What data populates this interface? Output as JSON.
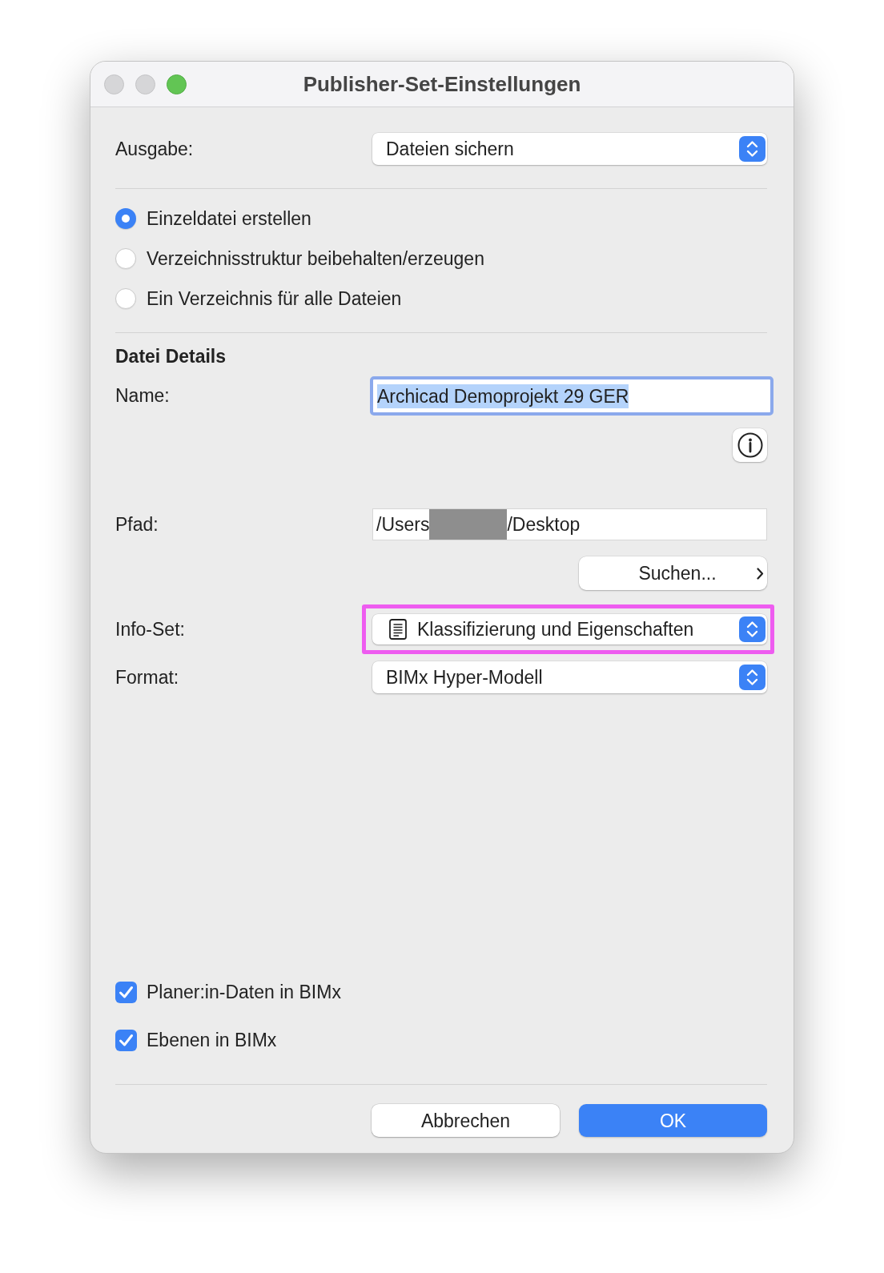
{
  "window": {
    "title": "Publisher-Set-Einstellungen",
    "controls": [
      {
        "kind": "close",
        "enabled": false
      },
      {
        "kind": "minimize",
        "enabled": false
      },
      {
        "kind": "zoom",
        "enabled": true
      }
    ]
  },
  "output": {
    "label": "Ausgabe:",
    "value": "Dateien sichern"
  },
  "file_options": [
    {
      "label": "Einzeldatei erstellen",
      "selected": true
    },
    {
      "label": "Verzeichnisstruktur beibehalten/erzeugen",
      "selected": false
    },
    {
      "label": "Ein Verzeichnis für alle Dateien",
      "selected": false
    }
  ],
  "file_details": {
    "heading": "Datei Details",
    "name": {
      "label": "Name:",
      "value": "Archicad Demoprojekt 29 GER",
      "focused": true,
      "text_selected": true
    },
    "path": {
      "label": "Pfad:",
      "value_start": "/Users",
      "redacted": true,
      "value_end": "/Desktop"
    },
    "browse_button": "Suchen...",
    "info_set": {
      "label": "Info-Set:",
      "value": "Klassifizierung und Eigenschaften",
      "highlighted": true
    },
    "format": {
      "label": "Format:",
      "value": "BIMx Hyper-Modell"
    }
  },
  "options": [
    {
      "label": "Planer:in-Daten in BIMx",
      "checked": true
    },
    {
      "label": "Ebenen in BIMx",
      "checked": true
    }
  ],
  "buttons": [
    {
      "label": "Abbrechen",
      "kind": "secondary"
    },
    {
      "label": "OK",
      "kind": "primary"
    }
  ]
}
